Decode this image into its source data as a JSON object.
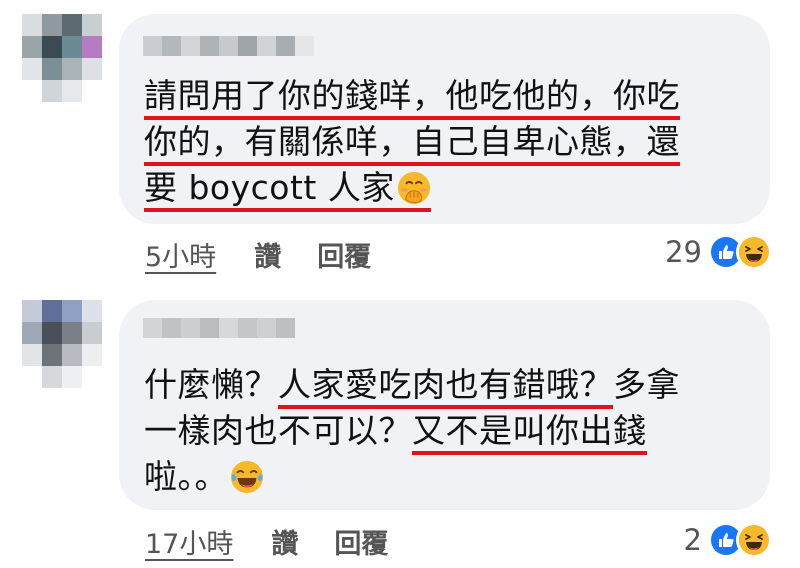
{
  "comments": [
    {
      "lines": [
        [
          {
            "text": "請問用了你的錢咩，他吃他的，你吃",
            "underline": true
          }
        ],
        [
          {
            "text": "你的，有關係咩，自己自卑心態，還",
            "underline": true
          }
        ],
        [
          {
            "text": "要 boycott 人家",
            "underline": true
          }
        ]
      ],
      "emoji": "hand-over-mouth-emoji",
      "time": "5小時",
      "like_label": "讚",
      "reply_label": "回覆",
      "reaction_count": "29"
    },
    {
      "lines": [
        [
          {
            "text": "什麼懶？",
            "underline": false
          },
          {
            "text": "人家愛吃肉也有錯哦？",
            "underline": true
          },
          {
            "text": "多拿",
            "underline": false
          }
        ],
        [
          {
            "text": "一樣肉也不可以？",
            "underline": false
          },
          {
            "text": "又不是叫你出錢",
            "underline": true
          }
        ],
        [
          {
            "text": "啦。。",
            "underline": false
          }
        ]
      ],
      "emoji": "tears-of-joy-emoji",
      "time": "17小時",
      "like_label": "讚",
      "reply_label": "回覆",
      "reaction_count": "2"
    }
  ],
  "reaction_icons": [
    "like-icon",
    "haha-icon"
  ],
  "colors": {
    "bubble": "#f0f2f5",
    "underline": "#e0121b",
    "like_blue": "#1877f2",
    "haha_yellow": "#f7b928"
  }
}
